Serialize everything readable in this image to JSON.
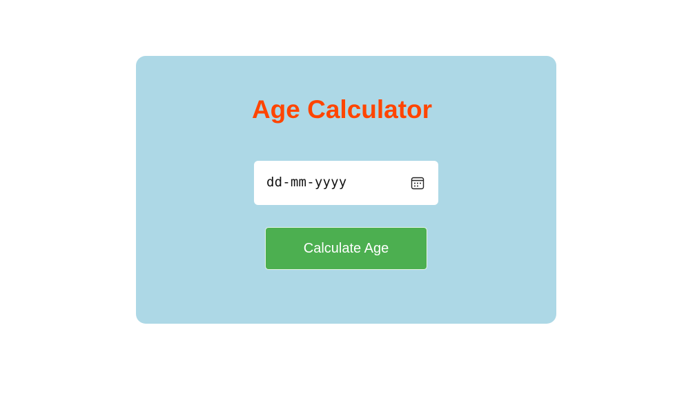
{
  "app": {
    "title": "Age Calculator"
  },
  "date_input": {
    "placeholder": "dd-mm-yyyy",
    "value": "",
    "icon": "calendar-icon"
  },
  "calculate_button": {
    "label": "Calculate Age"
  },
  "colors": {
    "page_background": "#ffffff",
    "card_background": "#add8e6",
    "title": "#ff4500",
    "button_background": "#4caf50",
    "button_text": "#ffffff",
    "input_background": "#ffffff"
  }
}
